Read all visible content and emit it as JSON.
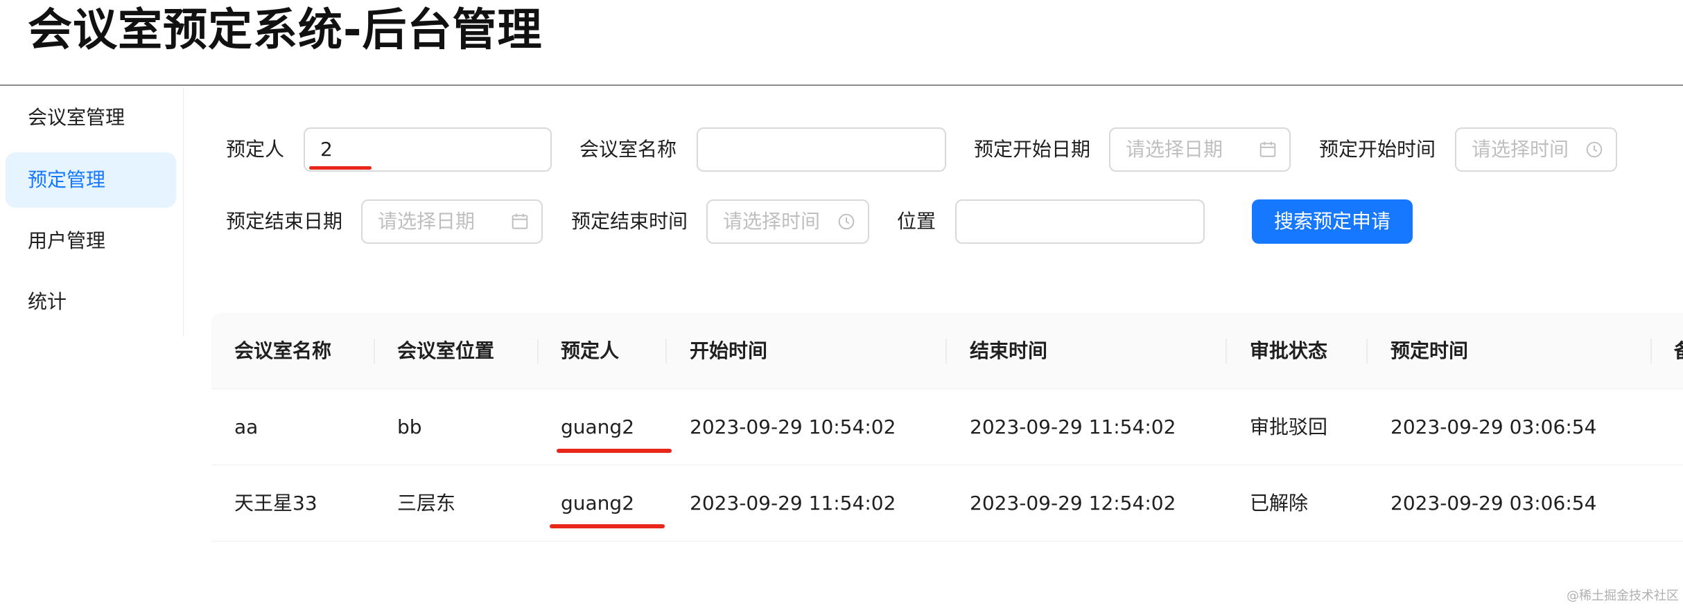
{
  "app": {
    "title": "会议室预定系统-后台管理"
  },
  "sidebar": {
    "items": [
      {
        "label": "会议室管理",
        "active": false
      },
      {
        "label": "预定管理",
        "active": true
      },
      {
        "label": "用户管理",
        "active": false
      },
      {
        "label": "统计",
        "active": false
      }
    ]
  },
  "search_form": {
    "booker_label": "预定人",
    "booker_value": "2",
    "room_name_label": "会议室名称",
    "room_name_value": "",
    "start_date_label": "预定开始日期",
    "start_date_placeholder": "请选择日期",
    "start_time_label": "预定开始时间",
    "start_time_placeholder": "请选择时间",
    "end_date_label": "预定结束日期",
    "end_date_placeholder": "请选择日期",
    "end_time_label": "预定结束时间",
    "end_time_placeholder": "请选择时间",
    "location_label": "位置",
    "location_value": "",
    "submit_label": "搜索预定申请"
  },
  "table": {
    "columns": [
      "会议室名称",
      "会议室位置",
      "预定人",
      "开始时间",
      "结束时间",
      "审批状态",
      "预定时间",
      "备"
    ],
    "rows": [
      [
        "aa",
        "bb",
        "guang2",
        "2023-09-29 10:54:02",
        "2023-09-29 11:54:02",
        "审批驳回",
        "2023-09-29 03:06:54"
      ],
      [
        "天王星33",
        "三层东",
        "guang2",
        "2023-09-29 11:54:02",
        "2023-09-29 12:54:02",
        "已解除",
        "2023-09-29 03:06:54"
      ]
    ]
  },
  "annotation": {
    "color": "#e8261a"
  },
  "theme": {
    "primary": "#1677ff",
    "active_bg": "#e6f4ff"
  },
  "watermark": "@稀土掘金技术社区"
}
